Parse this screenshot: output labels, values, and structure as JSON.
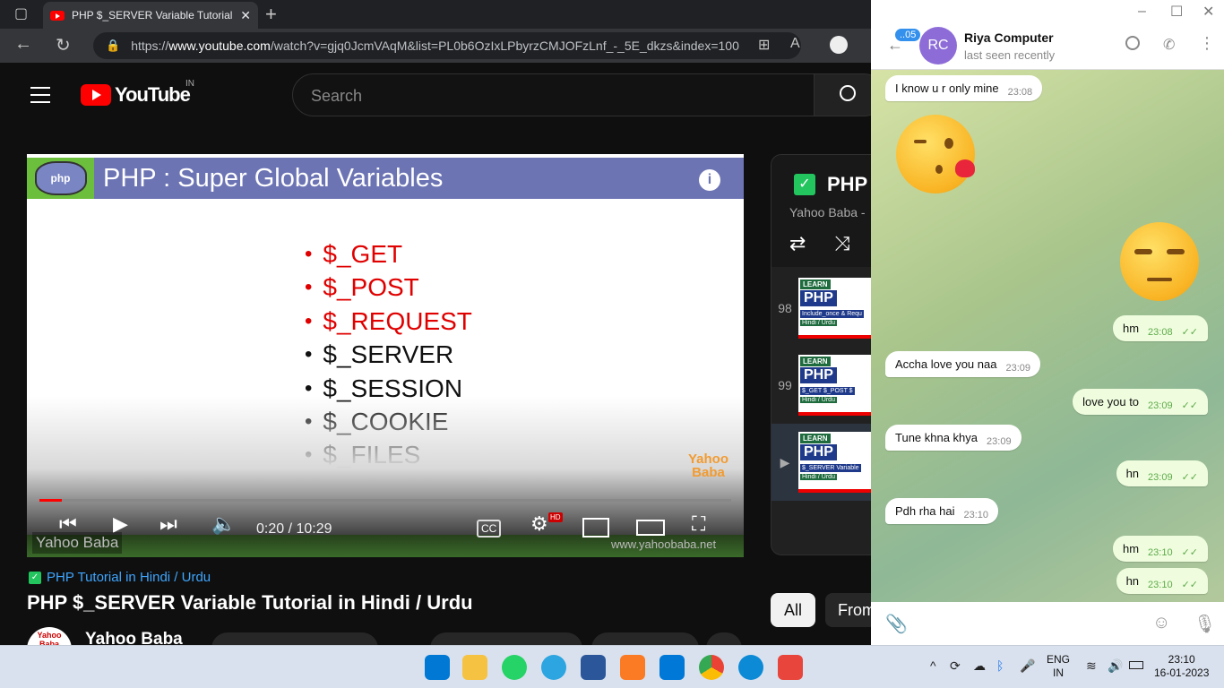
{
  "browser": {
    "tab_title": "PHP $_SERVER Variable Tutorial i",
    "url_prefix": "https://",
    "url_host": "www.youtube.com",
    "url_rest": "/watch?v=gjq0JcmVAqM&list=PL0b6OzIxLPbyrzCMJOFzLnf_-_5E_dkzs&index=100"
  },
  "youtube": {
    "logo_text": "YouTube",
    "region": "IN",
    "search_placeholder": "Search"
  },
  "video": {
    "slide_title": "PHP : Super Global Variables",
    "php_logo_text": "php",
    "vars": [
      {
        "text": "$_GET",
        "color": "#e00000"
      },
      {
        "text": "$_POST",
        "color": "#e00000"
      },
      {
        "text": "$_REQUEST",
        "color": "#e00000"
      },
      {
        "text": "$_SERVER",
        "color": "#111111"
      },
      {
        "text": "$_SESSION",
        "color": "#111111"
      },
      {
        "text": "$_COOKIE",
        "color": "#111111"
      },
      {
        "text": "$_FILES",
        "color": "#111111"
      }
    ],
    "brand_line1": "Yahoo",
    "brand_line2": "Baba",
    "time": "0:20 / 10:29",
    "progress": 0.032,
    "hd_badge": "HD",
    "cc_label": "CC",
    "watermark_left": "Yahoo Baba",
    "watermark_right": "www.yahoobaba.net"
  },
  "below": {
    "playlist_link": "PHP Tutorial in Hindi / Urdu",
    "title": "PHP $_SERVER Variable Tutorial in Hindi / Urdu",
    "channel": "Yahoo Baba",
    "channel_avatar_text": "Yahoo Baba"
  },
  "playlist": {
    "title": "PHP",
    "subtitle": "Yahoo Baba -",
    "items": [
      {
        "num": "98",
        "caption": "Include_once & Requ",
        "hindi": "Hindi / Urdu"
      },
      {
        "num": "99",
        "caption": "$_GET  $_POST  $",
        "hindi": "Hindi / Urdu"
      },
      {
        "num": "▶",
        "caption": "$_SERVER Variable",
        "hindi": "Hindi / Urdu"
      }
    ],
    "learn": "LEARN",
    "php": "PHP"
  },
  "chips": {
    "all": "All",
    "from": "From"
  },
  "telegram": {
    "badge": "..05",
    "avatar": "RC",
    "name": "Riya Computer",
    "status": "last seen recently",
    "messages": [
      {
        "dir": "in",
        "text": "I know u r only mine",
        "time": "23:08"
      },
      {
        "dir": "out",
        "text": "hm",
        "time": "23:08"
      },
      {
        "dir": "in",
        "text": "Accha love you naa",
        "time": "23:09"
      },
      {
        "dir": "out",
        "text": "love you to",
        "time": "23:09"
      },
      {
        "dir": "in",
        "text": "Tune khna khya",
        "time": "23:09"
      },
      {
        "dir": "out",
        "text": "hn",
        "time": "23:09"
      },
      {
        "dir": "in",
        "text": "Pdh rha hai",
        "time": "23:10"
      },
      {
        "dir": "out",
        "text": "hm",
        "time": "23:10"
      },
      {
        "dir": "out",
        "text": "hn",
        "time": "23:10"
      }
    ]
  },
  "taskbar": {
    "lang1": "ENG",
    "lang2": "IN",
    "time": "23:10",
    "date": "16-01-2023"
  }
}
